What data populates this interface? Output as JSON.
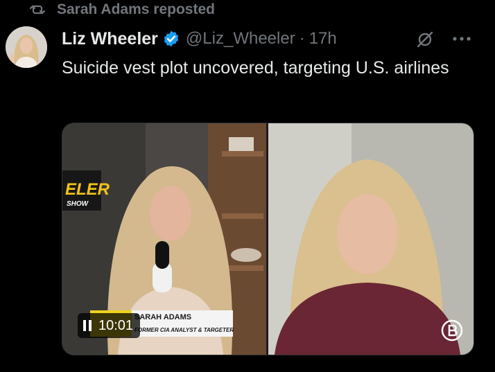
{
  "repost": {
    "text": "Sarah Adams reposted"
  },
  "post": {
    "author_name": "Liz Wheeler",
    "handle": "@Liz_Wheeler",
    "separator": "·",
    "time": "17h",
    "text": "Suicide vest plot uncovered, targeting U.S. airlines"
  },
  "video": {
    "timestamp": "10:01",
    "sign_text": "ELER",
    "sign_sub": "SHOW",
    "lower_third_name": "SARAH ADAMS",
    "lower_third_title": "FORMER CIA ANALYST & TARGETER",
    "state": "playing"
  },
  "colors": {
    "background": "#000000",
    "text_primary": "#e7e9ea",
    "text_secondary": "#71767b",
    "verified_blue": "#1d9bf0"
  },
  "icons": {
    "repost": "repost-icon",
    "verified": "verified-badge-icon",
    "grok": "grok-icon",
    "more": "more-options-icon",
    "pause": "pause-icon",
    "channel_logo": "channel-logo-icon"
  }
}
